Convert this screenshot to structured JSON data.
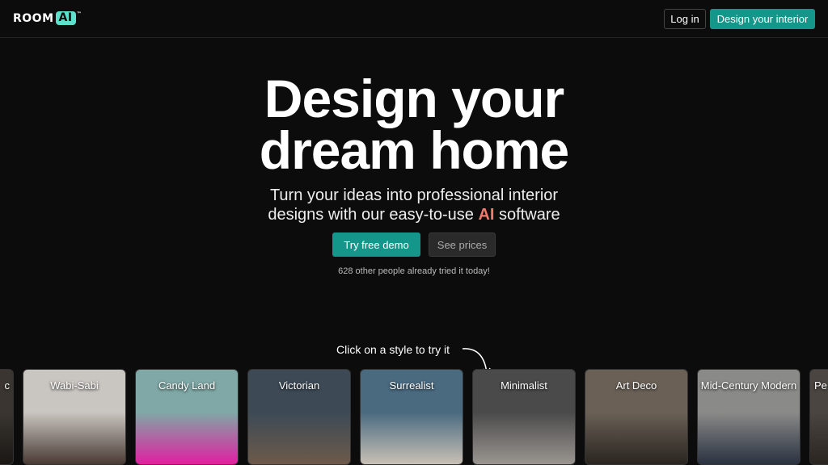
{
  "nav": {
    "logo_text": "ROOM",
    "logo_badge": "AI",
    "logo_tm": "™",
    "login": "Log in",
    "design": "Design your interior"
  },
  "hero": {
    "title_line1": "Design your",
    "title_line2": "dream home",
    "subtitle_line1": "Turn your ideas into professional interior",
    "subtitle_line2_pre": "designs with our easy-to-use ",
    "subtitle_highlight": "AI",
    "subtitle_line2_post": " software",
    "demo": "Try free demo",
    "prices": "See prices",
    "count": "628 other people already tried it today!"
  },
  "styles": {
    "hint": "Click on a style to try it",
    "items": [
      {
        "label": "c",
        "colors": [
          "#3a3530",
          "#1a1714"
        ]
      },
      {
        "label": "Wabi-Sabi",
        "colors": [
          "#c9c5c0",
          "#4a3a34"
        ]
      },
      {
        "label": "Candy Land",
        "colors": [
          "#7fa8a6",
          "#e020a0"
        ]
      },
      {
        "label": "Victorian",
        "colors": [
          "#3d4a56",
          "#6d5a4a"
        ]
      },
      {
        "label": "Surrealist",
        "colors": [
          "#4a6a80",
          "#c8c0b5"
        ]
      },
      {
        "label": "Minimalist",
        "colors": [
          "#4a4a4a",
          "#9a9590"
        ]
      },
      {
        "label": "Art Deco",
        "colors": [
          "#6a6056",
          "#2a2520"
        ]
      },
      {
        "label": "Mid-Century Modern",
        "colors": [
          "#8a8a88",
          "#2a3240"
        ]
      },
      {
        "label": "Pe",
        "colors": [
          "#4a4540",
          "#2a2520"
        ]
      }
    ]
  }
}
